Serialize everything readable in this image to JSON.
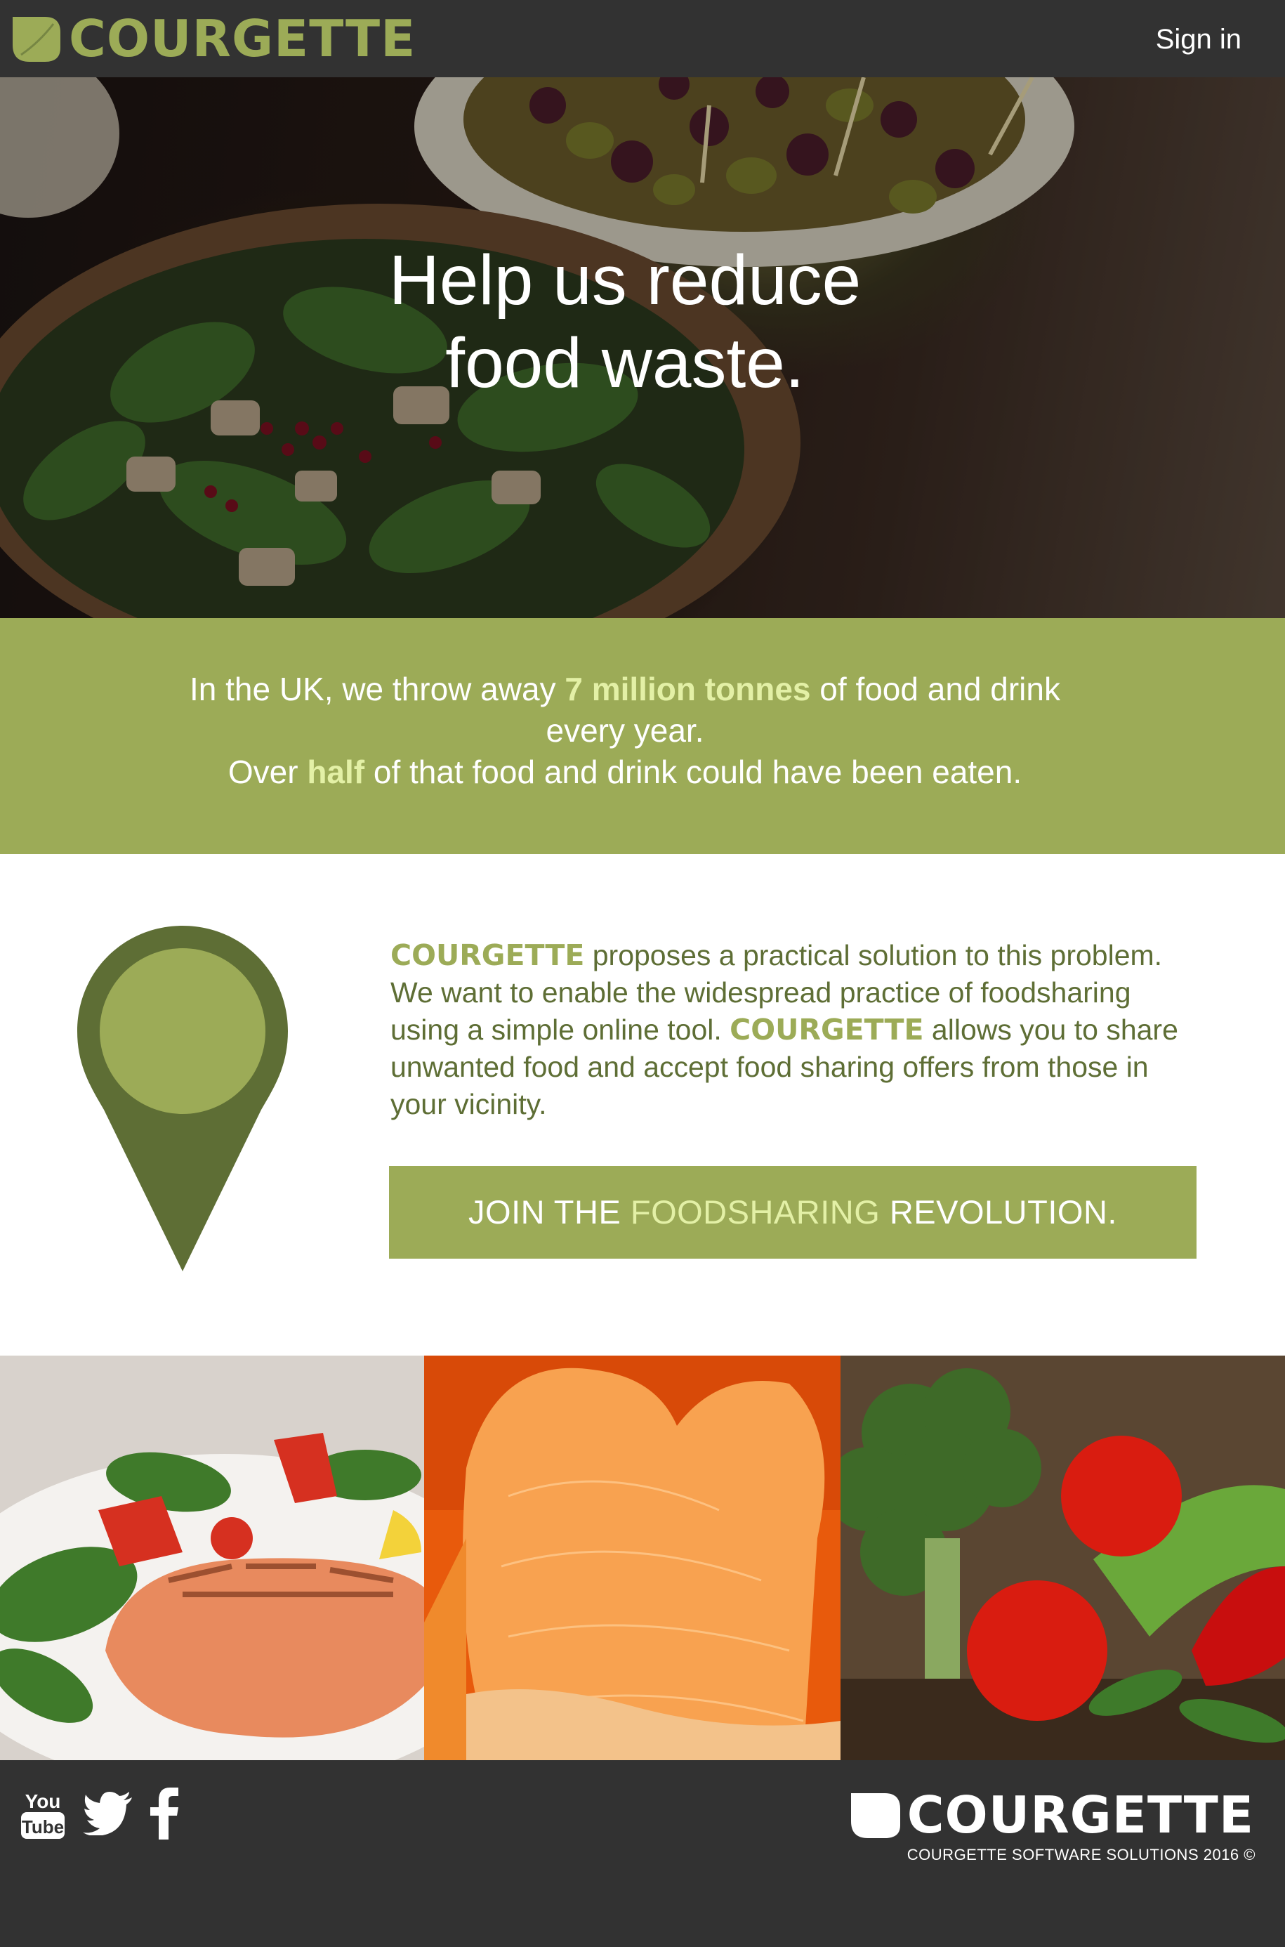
{
  "header": {
    "brand": "COURGETTE",
    "sign_in": "Sign in"
  },
  "hero": {
    "title_line1": "Help us reduce",
    "title_line2": "food waste."
  },
  "stats": {
    "line1_pre": "In the UK, we throw away ",
    "line1_highlight": "7 million tonnes",
    "line1_post": " of food and drink every year.",
    "line2_pre": "Over ",
    "line2_highlight": "half",
    "line2_post": " of that food and drink could have been eaten."
  },
  "intro": {
    "brand_1": "COURGETTE",
    "text_1": " proposes a practical solution to this problem. We want to enable the widespread practice of foodsharing using a simple online tool. ",
    "brand_2": "COURGETTE",
    "text_2": " allows you to share unwanted food and accept food sharing offers from those in your vicinity.",
    "icon": "map-pin-icon"
  },
  "cta": {
    "pre": "JOIN THE ",
    "highlight": "FOODSHARING",
    "post": " REVOLUTION."
  },
  "footer": {
    "social": [
      {
        "name": "youtube-icon",
        "label_top": "You",
        "label_bottom": "Tube"
      },
      {
        "name": "twitter-icon"
      },
      {
        "name": "facebook-icon"
      }
    ],
    "brand": "COURGETTE",
    "copyright": "COURGETTE SOFTWARE SOLUTIONS 2016 ©"
  },
  "colors": {
    "dark": "#323232",
    "accent": "#9cab57",
    "accent_dark": "#5e6e35",
    "highlight": "#e3f0a6"
  }
}
